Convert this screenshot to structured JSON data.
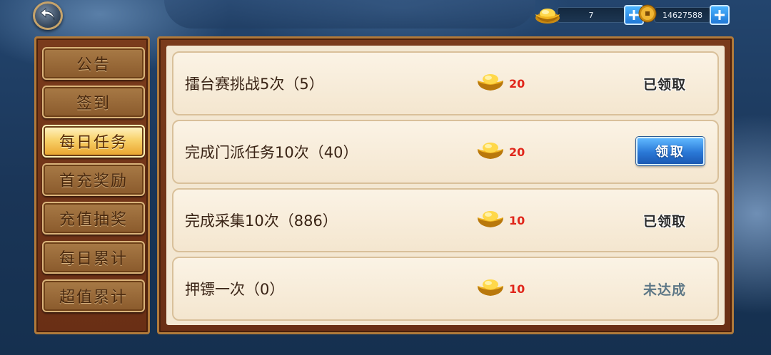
{
  "currency": {
    "gold_ingot_amount": "7",
    "coin_amount": "14627588"
  },
  "sidebar": {
    "items": [
      {
        "label": "公告",
        "active": false
      },
      {
        "label": "签到",
        "active": false
      },
      {
        "label": "每日任务",
        "active": true
      },
      {
        "label": "首充奖励",
        "active": false
      },
      {
        "label": "充值抽奖",
        "active": false
      },
      {
        "label": "每日累计",
        "active": false
      },
      {
        "label": "超值累计",
        "active": false
      }
    ]
  },
  "tasks": [
    {
      "title": "擂台赛挑战5次（5）",
      "reward": "20",
      "status": "已领取",
      "state": "claimed"
    },
    {
      "title": "完成门派任务10次（40）",
      "reward": "20",
      "status": "领取",
      "state": "claimable"
    },
    {
      "title": "完成采集10次（886）",
      "reward": "10",
      "status": "已领取",
      "state": "claimed"
    },
    {
      "title": "押镖一次（0）",
      "reward": "10",
      "status": "未达成",
      "state": "unfinished"
    }
  ],
  "icons": {
    "back": "back-arrow-icon",
    "ingot": "gold-ingot-icon",
    "coin": "copper-coin-icon",
    "plus": "plus-icon"
  },
  "colors": {
    "reward_red": "#e0261b",
    "active_tab_gold": "#f8d26b",
    "claim_blue": "#2a78d6"
  }
}
